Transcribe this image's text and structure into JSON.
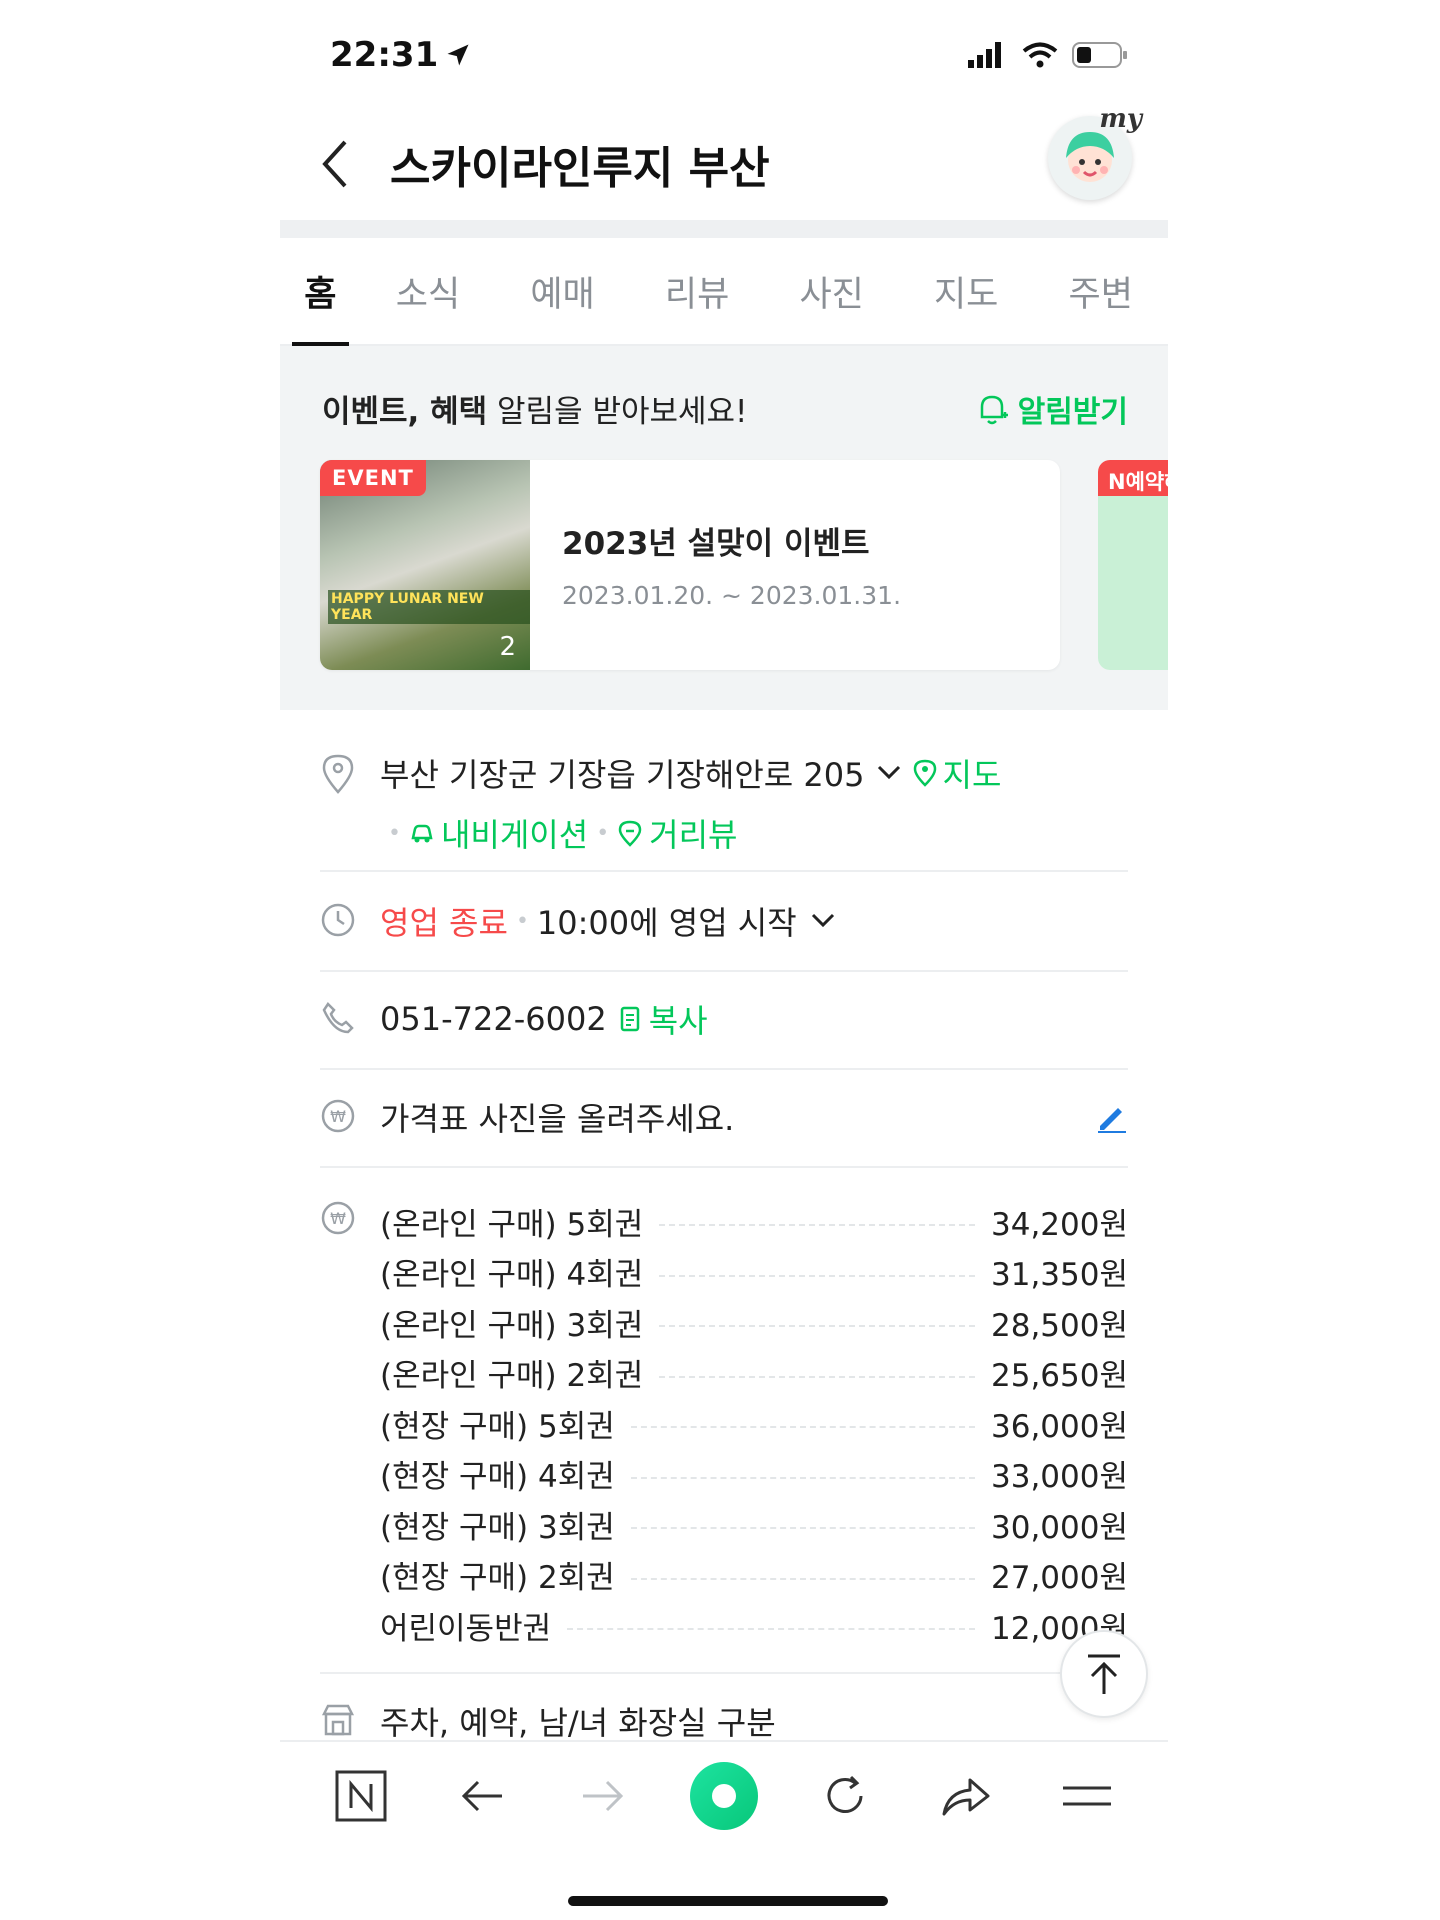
{
  "status_bar": {
    "time": "22:31"
  },
  "header": {
    "title": "스카이라인루지 부산",
    "avatar_label": "my"
  },
  "tabs": [
    {
      "label": "홈",
      "active": true
    },
    {
      "label": "소식",
      "active": false
    },
    {
      "label": "예매",
      "active": false
    },
    {
      "label": "리뷰",
      "active": false
    },
    {
      "label": "사진",
      "active": false
    },
    {
      "label": "지도",
      "active": false
    },
    {
      "label": "주변",
      "active": false
    }
  ],
  "events": {
    "heading_bold": "이벤트, 혜택",
    "heading_rest": " 알림을 받아보세요!",
    "notify_label": "알림받기",
    "card": {
      "badge": "EVENT",
      "image_caption": "HAPPY LUNAR NEW YEAR",
      "image_count": "2",
      "title": "2023년 설맞이 이벤트",
      "date": "2023.01.20. ~ 2023.01.31."
    },
    "card2_badge": "N예약혜"
  },
  "info": {
    "address": "부산 기장군 기장읍 기장해안로 205",
    "map_link": "지도",
    "navigation_link": "내비게이션",
    "streetview_link": "거리뷰",
    "status": "영업 종료",
    "hours_text": "10:00에 영업 시작",
    "phone": "051-722-6002",
    "copy_label": "복사",
    "price_photo_prompt": "가격표 사진을 올려주세요.",
    "prices": [
      {
        "name": "(온라인 구매) 5회권",
        "price": "34,200원"
      },
      {
        "name": "(온라인 구매) 4회권",
        "price": "31,350원"
      },
      {
        "name": "(온라인 구매) 3회권",
        "price": "28,500원"
      },
      {
        "name": "(온라인 구매) 2회권",
        "price": "25,650원"
      },
      {
        "name": "(현장 구매) 5회권",
        "price": "36,000원"
      },
      {
        "name": "(현장 구매) 4회권",
        "price": "33,000원"
      },
      {
        "name": "(현장 구매) 3회권",
        "price": "30,000원"
      },
      {
        "name": "(현장 구매) 2회권",
        "price": "27,000원"
      },
      {
        "name": "어린이동반권",
        "price": "12,000원"
      }
    ],
    "facilities": "주차, 예약, 남/녀 화장실 구분"
  },
  "colors": {
    "accent_green": "#03c75a",
    "closed_red": "#f64a4a"
  },
  "toolbar_icons": [
    "naver-n-icon",
    "back-arrow-icon",
    "forward-arrow-icon",
    "green-dot-home-icon",
    "refresh-icon",
    "share-icon",
    "menu-icon"
  ]
}
